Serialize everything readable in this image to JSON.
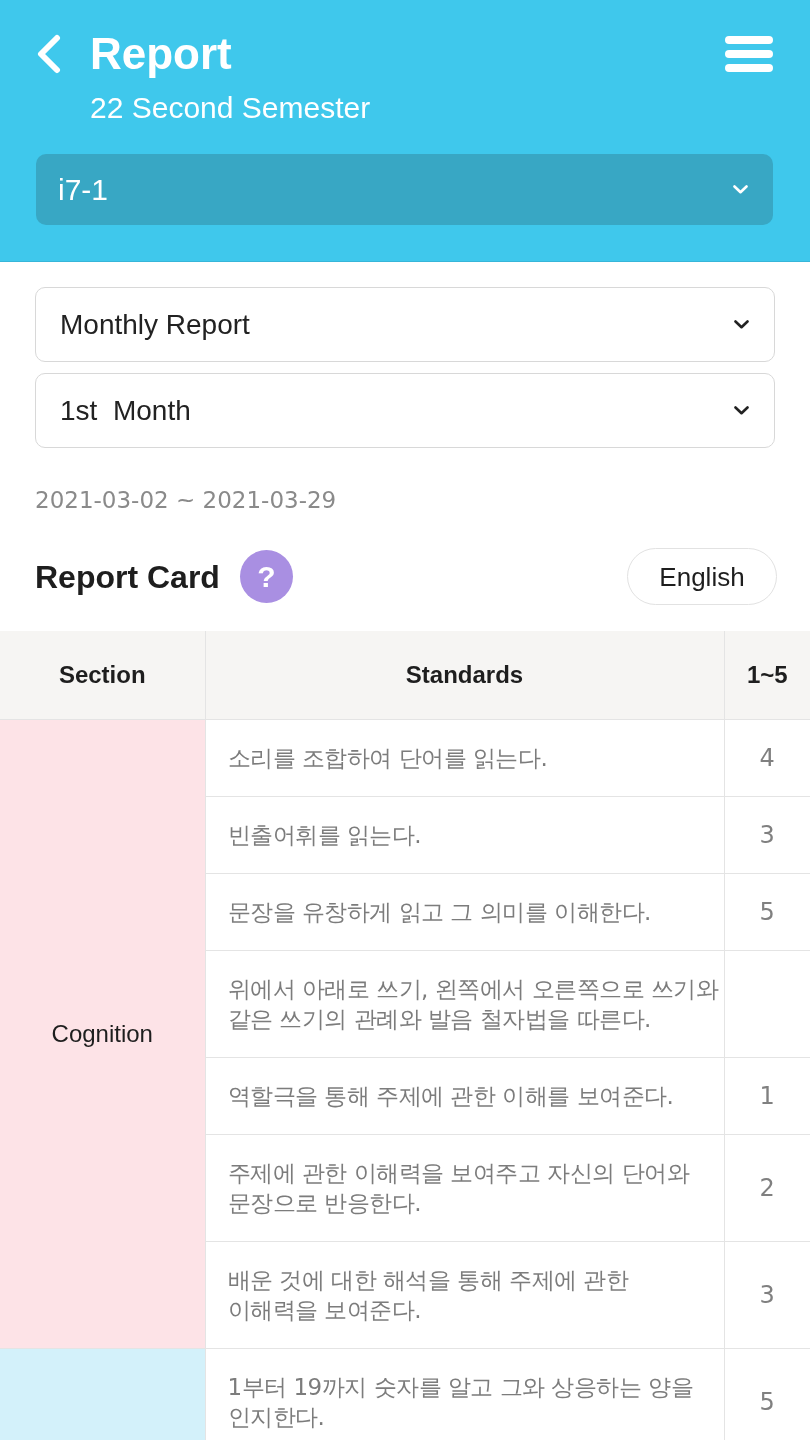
{
  "header": {
    "title": "Report",
    "subtitle": "22 Second Semester",
    "class_select": {
      "value": "i7-1"
    }
  },
  "filters": [
    {
      "value": "Monthly Report"
    },
    {
      "value": "1st  Month"
    }
  ],
  "date_range": "2021-03-02 ~ 2021-03-29",
  "report_card": {
    "title": "Report Card",
    "help_button": "?",
    "language_button": "English"
  },
  "table": {
    "columns": [
      "Section",
      "Standards",
      "1~5"
    ],
    "sections": [
      {
        "name": "Cognition",
        "color": "#fde3e7",
        "rows": [
          {
            "standard": "소리를 조합하여 단어를 읽는다.",
            "score": "4"
          },
          {
            "standard": "빈출어휘를 읽는다.",
            "score": "3"
          },
          {
            "standard": "문장을 유창하게 읽고 그 의미를 이해한다.",
            "score": "5"
          },
          {
            "standard": "위에서 아래로 쓰기, 왼쪽에서 오른쪽으로 쓰기와 같은 쓰기의 관례와 발음 철자법을 따른다."
          },
          {
            "standard": "역할극을 통해 주제에 관한 이해를 보여준다.",
            "score": "1"
          },
          {
            "standard": "주제에 관한 이해력을 보여주고 자신의 단어와 문장으로 반응한다.",
            "score": "2"
          },
          {
            "standard": "배운 것에 대한 해석을 통해 주제에 관한 이해력을 보여준다.",
            "score": "3"
          }
        ]
      },
      {
        "color": "#d3f1fa",
        "rows": [
          {
            "standard": "1부터 19까지 숫자를 알고 그와 상응하는 양을 인지한다.",
            "score": "5"
          }
        ]
      }
    ]
  }
}
